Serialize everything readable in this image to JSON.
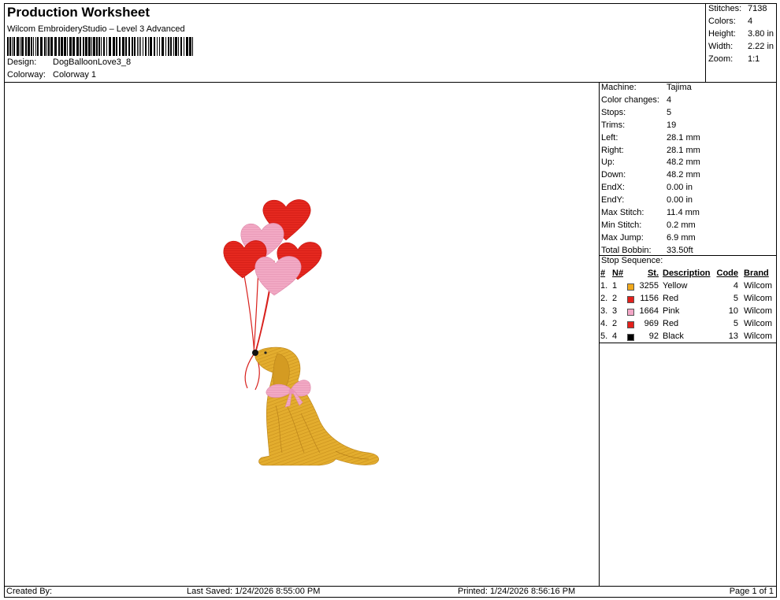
{
  "header": {
    "title": "Production Worksheet",
    "subtitle": "Wilcom EmbroideryStudio – Level 3 Advanced",
    "design_label": "Design:",
    "design_value": "DogBalloonLove3_8",
    "colorway_label": "Colorway:",
    "colorway_value": "Colorway 1"
  },
  "stats": {
    "stitches_label": "Stitches:",
    "stitches_value": "7138",
    "colors_label": "Colors:",
    "colors_value": "4",
    "height_label": "Height:",
    "height_value": "3.80 in",
    "width_label": "Width:",
    "width_value": "2.22 in",
    "zoom_label": "Zoom:",
    "zoom_value": "1:1"
  },
  "machine": [
    {
      "label": "Machine:",
      "value": "Tajima"
    },
    {
      "label": "Color changes:",
      "value": "4"
    },
    {
      "label": "Stops:",
      "value": "5"
    },
    {
      "label": "Trims:",
      "value": "19"
    },
    {
      "label": "Left:",
      "value": "28.1 mm"
    },
    {
      "label": "Right:",
      "value": "28.1 mm"
    },
    {
      "label": "Up:",
      "value": "48.2 mm"
    },
    {
      "label": "Down:",
      "value": "48.2 mm"
    },
    {
      "label": "EndX:",
      "value": "0.00 in"
    },
    {
      "label": "EndY:",
      "value": "0.00 in"
    },
    {
      "label": "Max Stitch:",
      "value": "11.4 mm"
    },
    {
      "label": "Min Stitch:",
      "value": "0.2 mm"
    },
    {
      "label": "Max Jump:",
      "value": "6.9 mm"
    },
    {
      "label": "Total Bobbin:",
      "value": "33.50ft"
    }
  ],
  "sequence": {
    "title": "Stop Sequence:",
    "headers": {
      "num": "#",
      "n": "N#",
      "st": "St.",
      "desc": "Description",
      "code": "Code",
      "brand": "Brand"
    },
    "rows": [
      {
        "num": "1.",
        "n": "1",
        "color": "#f0a81c",
        "st": "3255",
        "desc": "Yellow",
        "code": "4",
        "brand": "Wilcom"
      },
      {
        "num": "2.",
        "n": "2",
        "color": "#e3201b",
        "st": "1156",
        "desc": "Red",
        "code": "5",
        "brand": "Wilcom"
      },
      {
        "num": "3.",
        "n": "3",
        "color": "#f2a6c6",
        "st": "1664",
        "desc": "Pink",
        "code": "10",
        "brand": "Wilcom"
      },
      {
        "num": "4.",
        "n": "2",
        "color": "#e3201b",
        "st": "969",
        "desc": "Red",
        "code": "5",
        "brand": "Wilcom"
      },
      {
        "num": "5.",
        "n": "4",
        "color": "#000000",
        "st": "92",
        "desc": "Black",
        "code": "13",
        "brand": "Wilcom"
      }
    ]
  },
  "footer": {
    "created_by": "Created By:",
    "last_saved": "Last Saved: 1/24/2026 8:55:00 PM",
    "printed": "Printed: 1/24/2026 8:56:16 PM",
    "page": "Page 1 of 1"
  },
  "colors": {
    "dog": "#e0a82a",
    "dog_shade": "#b9821a",
    "heart_red": "#e3201b",
    "heart_pink": "#f0a3c0",
    "bow": "#f2a6c6"
  }
}
